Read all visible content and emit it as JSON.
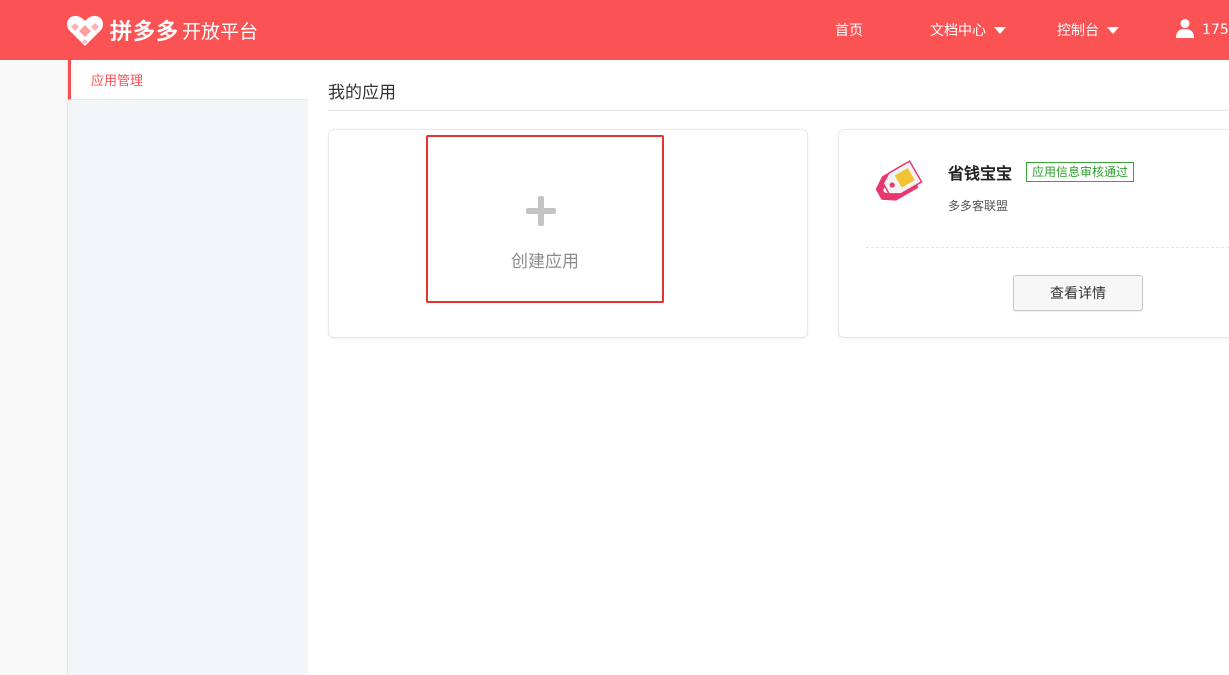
{
  "header": {
    "brand": "拼多多",
    "platform": "开放平台",
    "nav": [
      {
        "label": "首页"
      },
      {
        "label": "文档中心"
      },
      {
        "label": "控制台"
      }
    ],
    "user": "175"
  },
  "sidebar": {
    "items": [
      {
        "label": "应用管理"
      }
    ]
  },
  "main": {
    "title": "我的应用",
    "create_label": "创建应用",
    "apps": [
      {
        "name": "省钱宝宝",
        "status": "应用信息审核通过",
        "type": "多多客联盟",
        "detail_button": "查看详情"
      }
    ]
  },
  "colors": {
    "brand": "#fb5254",
    "highlight": "#e53232",
    "status_green": "#2e9e2e"
  }
}
